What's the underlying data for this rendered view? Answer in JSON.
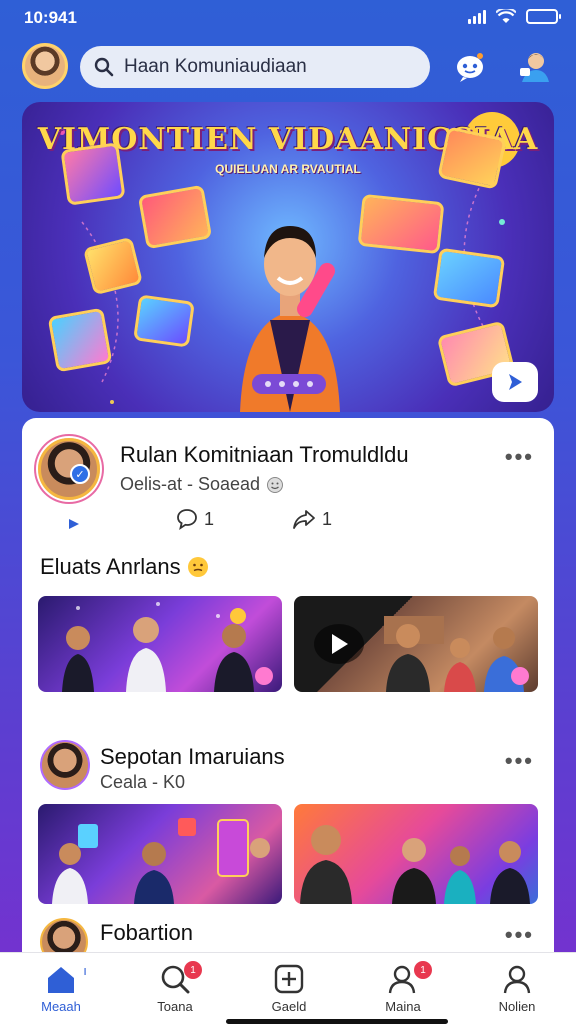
{
  "status": {
    "time": "10:941"
  },
  "search": {
    "placeholder": "Haan Komuniaudiaan"
  },
  "hero": {
    "title": "VIMONTIEN VIDAANICSIAA",
    "subtitle": "QUIELUAN AR RVAUTIAL"
  },
  "post1": {
    "title": "Rulan Komitniaan Tromuldldu",
    "subtitle": "Oelis-at - Soaead",
    "comments": "1",
    "shares": "1"
  },
  "section": {
    "title": "Eluats Anrlans"
  },
  "post2": {
    "title": "Sepotan Imaruians",
    "subtitle": "Ceala - K0"
  },
  "post3": {
    "title": "Fobartion"
  },
  "nav": {
    "items": [
      {
        "label": "Meaah"
      },
      {
        "label": "Toana"
      },
      {
        "label": "Gaeld"
      },
      {
        "label": "Maina"
      },
      {
        "label": "Nolien"
      }
    ]
  },
  "colors": {
    "accent": "#2f5fd6",
    "badge": "#e8384f",
    "hero_title": "#ffd84a"
  },
  "icons": [
    "search-icon",
    "chatbot-icon",
    "profile-icon",
    "play-icon",
    "comment-icon",
    "share-icon",
    "more-icon",
    "home-icon",
    "search-nav-icon",
    "plus-icon",
    "people-icon",
    "user-icon"
  ]
}
